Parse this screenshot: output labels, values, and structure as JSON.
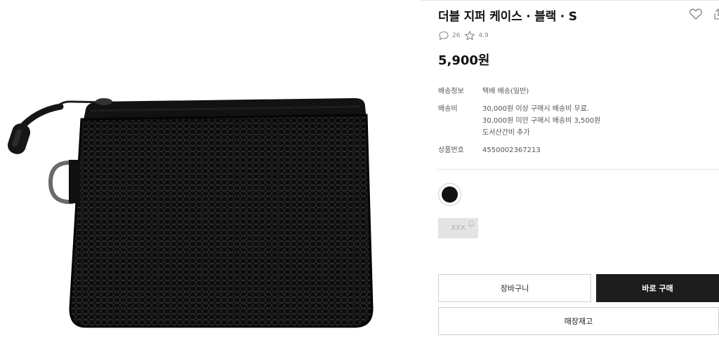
{
  "product": {
    "title": "더블 지퍼 케이스 · 블랙 · S",
    "review_count": "26",
    "rating": "4.9",
    "price": "5,900원"
  },
  "icons": {
    "wishlist": "heart-icon",
    "share": "share-icon",
    "review": "speech-bubble-icon",
    "rating": "star-icon",
    "size_notify": "bell-icon"
  },
  "specs": [
    {
      "label": "배송정보",
      "lines": [
        "택배 배송(일반)"
      ]
    },
    {
      "label": "배송비",
      "lines": [
        "30,000원 이상 구매시 배송비 무료.",
        "30,000원 미만 구매시 배송비 3,500원",
        "도서산간비 추가"
      ]
    },
    {
      "label": "상품번호",
      "lines": [
        "4550002367213"
      ]
    }
  ],
  "options": {
    "selected_color": "#111111",
    "size_label": "XXX"
  },
  "buttons": {
    "cart": "장바구니",
    "buy_now": "바로 구매",
    "store_stock": "매장재고"
  }
}
